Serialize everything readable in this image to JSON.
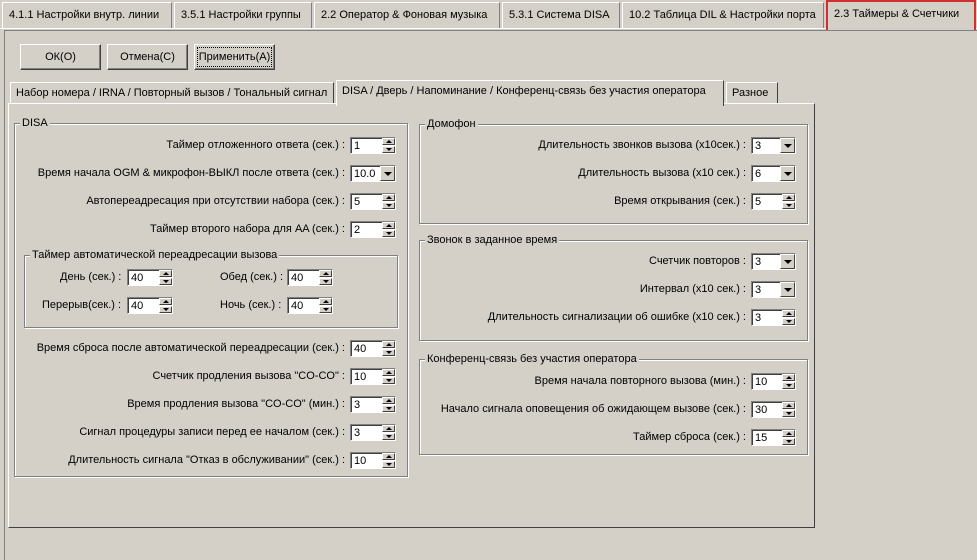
{
  "top_tabs": [
    {
      "label": "4.1.1 Настройки внутр. линии"
    },
    {
      "label": "3.5.1 Настройки группы"
    },
    {
      "label": "2.2 Оператор & Фоновая музыка"
    },
    {
      "label": "5.3.1 Система DISA"
    },
    {
      "label": "10.2 Таблица DIL & Настройки порта"
    },
    {
      "label": "2.3 Таймеры & Счетчики"
    }
  ],
  "buttons": {
    "ok": "ОК(O)",
    "cancel": "Отмена(С)",
    "apply": "Применить(А)"
  },
  "inner_tabs": [
    {
      "label": "Набор номера / IRNA / Повторный вызов / Тональный сигнал"
    },
    {
      "label": "DISA / Дверь / Напоминание / Конференц-связь без участия оператора"
    },
    {
      "label": "Разное"
    }
  ],
  "disa": {
    "title": "DISA",
    "rows": [
      {
        "label": "Таймер отложенного ответа (сек.) :",
        "value": "1"
      },
      {
        "label": "Время начала OGM & микрофон-ВЫКЛ после ответа (сек.) :",
        "value": "10.0"
      },
      {
        "label": "Автопереадресация при отсутствии набора (сек.) :",
        "value": "5"
      },
      {
        "label": "Таймер второго набора для AA (сек.) :",
        "value": "2"
      }
    ],
    "auto_forward": {
      "title": "Таймер автоматической переадресации вызова",
      "day_label": "День (сек.) :",
      "day_value": "40",
      "lunch_label": "Обед (сек.) :",
      "lunch_value": "40",
      "break_label": "Перерыв(сек.) :",
      "break_value": "40",
      "night_label": "Ночь (сек.) :",
      "night_value": "40"
    },
    "rows2": [
      {
        "label": "Время сброса после автоматической переадресации (сек.) :",
        "value": "40"
      },
      {
        "label": "Счетчик продления вызова \"CO-CO\" :",
        "value": "10"
      },
      {
        "label": "Время продления вызова \"CO-CO\" (мин.) :",
        "value": "3"
      },
      {
        "label": "Сигнал процедуры записи перед ее началом (сек.) :",
        "value": "3"
      },
      {
        "label": "Длительность сигнала \"Отказ в обслуживании\" (сек.) :",
        "value": "10"
      }
    ]
  },
  "doorphone": {
    "title": "Домофон",
    "rows": [
      {
        "label": "Длительность звонков вызова (x10сек.) :",
        "value": "3"
      },
      {
        "label": "Длительность вызова (x10 сек.) :",
        "value": "6"
      },
      {
        "label": "Время открывания (сек.) :",
        "value": "5"
      }
    ]
  },
  "timed_reminder": {
    "title": "Звонок в заданное время",
    "rows": [
      {
        "label": "Счетчик повторов :",
        "value": "3"
      },
      {
        "label": "Интервал (x10 сек.) :",
        "value": "3"
      },
      {
        "label": "Длительность сигнализации об ошибке (x10 сек.) :",
        "value": "3"
      }
    ]
  },
  "conference": {
    "title": "Конференц-связь без участия оператора",
    "rows": [
      {
        "label": "Время начала повторного вызова (мин.) :",
        "value": "10"
      },
      {
        "label": "Начало сигнала оповещения об ожидающем вызове (сек.) :",
        "value": "30"
      },
      {
        "label": "Таймер сброса (сек.) :",
        "value": "15"
      }
    ]
  }
}
